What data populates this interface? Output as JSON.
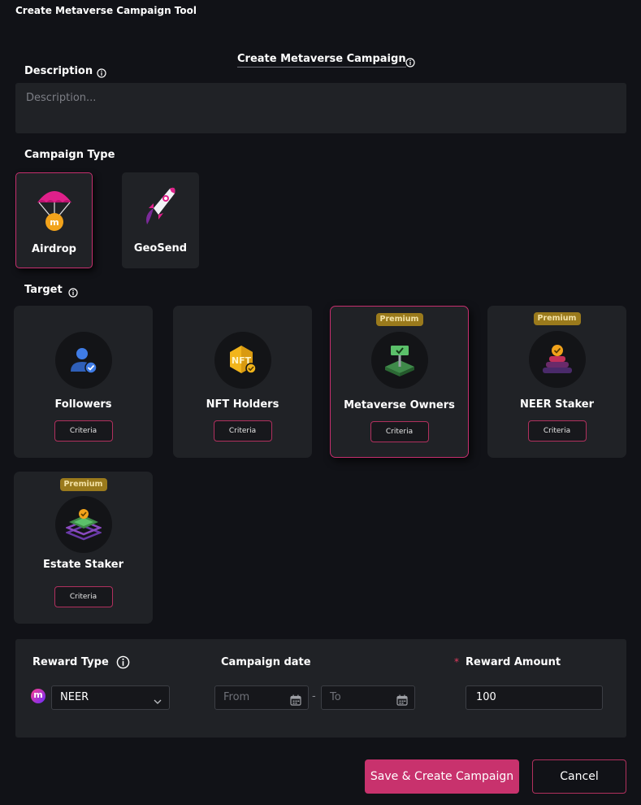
{
  "app_title": "Create Metaverse Campaign Tool",
  "form_title": "Create Metaverse Campaign",
  "description": {
    "label": "Description",
    "placeholder": "Description..."
  },
  "campaign_type": {
    "label": "Campaign Type",
    "options": [
      {
        "label": "Airdrop",
        "selected": true,
        "icon": "parachute-icon"
      },
      {
        "label": "GeoSend",
        "selected": false,
        "icon": "rocket-icon"
      }
    ]
  },
  "target": {
    "label": "Target",
    "premium_label": "Premium",
    "criteria_label": "Criteria",
    "cards": [
      {
        "label": "Followers",
        "premium": false,
        "selected": false,
        "icon": "user-verified-icon"
      },
      {
        "label": "NFT Holders",
        "premium": false,
        "selected": false,
        "icon": "nft-badge-icon"
      },
      {
        "label": "Metaverse Owners",
        "premium": true,
        "selected": true,
        "icon": "land-sign-icon"
      },
      {
        "label": "NEER Staker",
        "premium": true,
        "selected": false,
        "icon": "coin-stack-icon"
      },
      {
        "label": "Estate Staker",
        "premium": true,
        "selected": false,
        "icon": "estate-layers-icon"
      }
    ]
  },
  "reward": {
    "type_label": "Reward Type",
    "token_logo": "m",
    "token_value": "NEER",
    "date_label": "Campaign date",
    "from_placeholder": "From",
    "date_separator": "-",
    "to_placeholder": "To",
    "amount_label": "Reward Amount",
    "required_mark": "*",
    "amount_value": "100"
  },
  "buttons": {
    "save": "Save & Create Campaign",
    "cancel": "Cancel"
  },
  "colors": {
    "accent": "#c8326d",
    "premium": "#9a7a1c",
    "background": "#111217",
    "card": "#202226"
  }
}
